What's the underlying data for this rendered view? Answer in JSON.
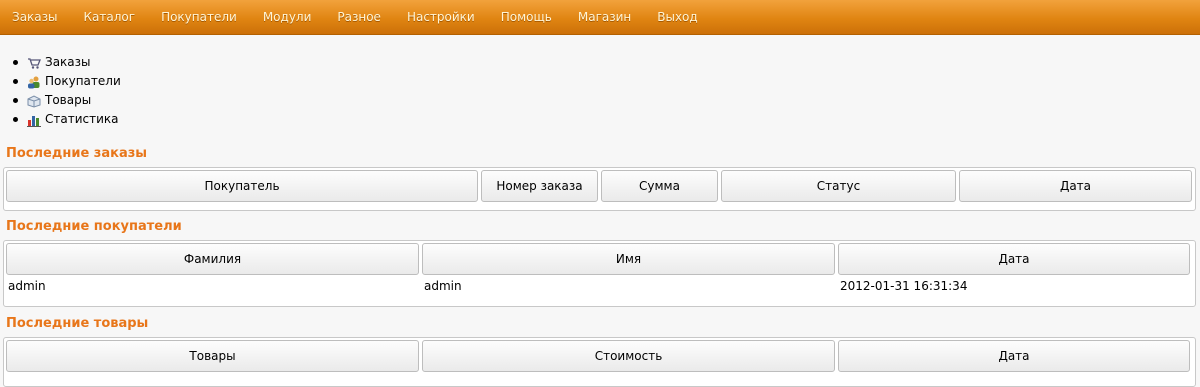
{
  "nav": {
    "items": [
      "Заказы",
      "Каталог",
      "Покупатели",
      "Модули",
      "Разное",
      "Настройки",
      "Помощь",
      "Магазин",
      "Выход"
    ]
  },
  "quick_links": [
    {
      "label": "Заказы",
      "icon": "cart-icon"
    },
    {
      "label": "Покупатели",
      "icon": "users-icon"
    },
    {
      "label": "Товары",
      "icon": "box-icon"
    },
    {
      "label": "Статистика",
      "icon": "bar-chart-icon"
    }
  ],
  "orders": {
    "title": "Последние заказы",
    "columns": [
      "Покупатель",
      "Номер заказа",
      "Сумма",
      "Статус",
      "Дата"
    ]
  },
  "customers": {
    "title": "Последние покупатели",
    "columns": [
      "Фамилия",
      "Имя",
      "Дата"
    ],
    "rows": [
      [
        "admin",
        "admin",
        "2012-01-31 16:31:34"
      ]
    ]
  },
  "products": {
    "title": "Последние товары",
    "columns": [
      "Товары",
      "Стоимость",
      "Дата"
    ]
  },
  "colors": {
    "accent": "#e08512",
    "section_title": "#e8761a"
  }
}
